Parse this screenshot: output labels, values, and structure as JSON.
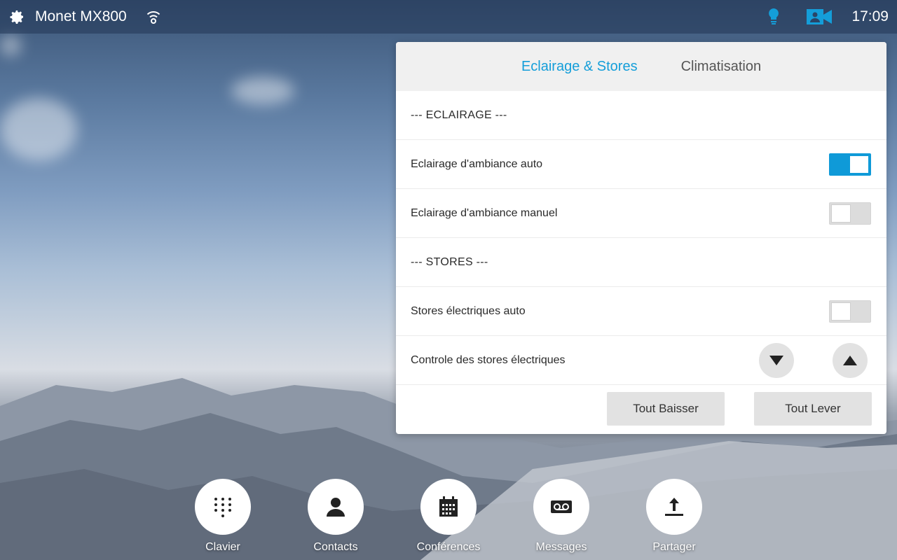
{
  "topbar": {
    "device_name": "Monet MX800",
    "time": "17:09",
    "icons": [
      "gear-icon",
      "wifi-icon",
      "lightbulb-icon",
      "video-camera-icon"
    ]
  },
  "panel": {
    "tabs": [
      {
        "label": "Eclairage & Stores",
        "active": true
      },
      {
        "label": "Climatisation",
        "active": false
      }
    ],
    "rows": {
      "lighting_header": "--- ECLAIRAGE ---",
      "ambient_auto": {
        "label": "Eclairage d'ambiance auto",
        "state": "on"
      },
      "ambient_manual": {
        "label": "Eclairage d'ambiance manuel",
        "state": "off"
      },
      "blinds_header": "--- STORES ---",
      "blinds_auto": {
        "label": "Stores électriques auto",
        "state": "off"
      },
      "blinds_control": {
        "label": "Controle des stores électriques"
      }
    },
    "buttons": {
      "lower_all": "Tout Baisser",
      "raise_all": "Tout Lever"
    },
    "accent_color": "#149ed9"
  },
  "dock": {
    "items": [
      {
        "label": "Clavier",
        "icon": "keypad-icon"
      },
      {
        "label": "Contacts",
        "icon": "contact-icon"
      },
      {
        "label": "Conférences",
        "icon": "calendar-icon"
      },
      {
        "label": "Messages",
        "icon": "voicemail-icon"
      },
      {
        "label": "Partager",
        "icon": "share-icon"
      }
    ]
  }
}
